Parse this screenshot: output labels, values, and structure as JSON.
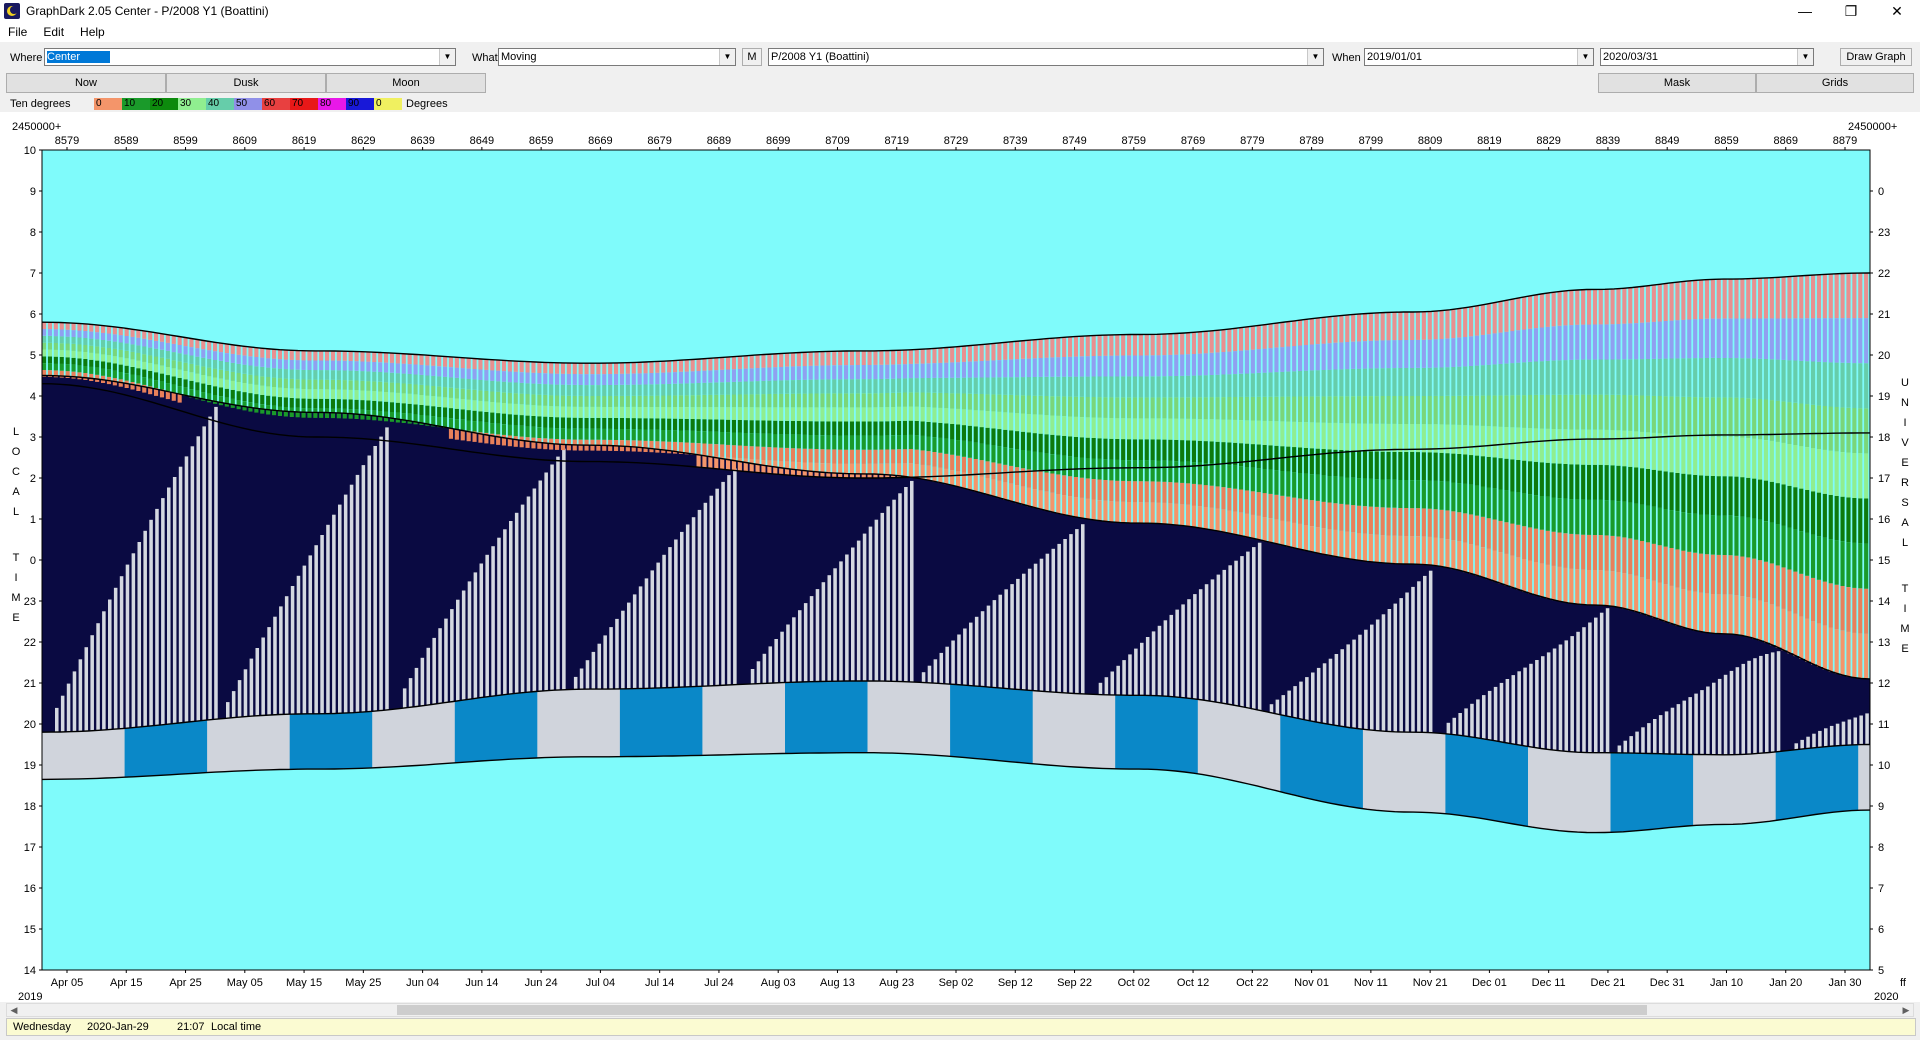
{
  "window": {
    "title": "GraphDark 2.05  Center  -  P/2008 Y1 (Boattini)"
  },
  "menu": [
    "File",
    "Edit",
    "Help"
  ],
  "toolbar": {
    "where_label": "Where",
    "where_value": "Center",
    "what_label": "What",
    "what_value": "Moving",
    "m_button": "M",
    "object_value": "P/2008 Y1 (Boattini)",
    "when_label": "When",
    "from_date": "2019/01/01",
    "to_date": "2020/03/31",
    "draw_button": "Draw Graph",
    "now_button": "Now",
    "dusk_button": "Dusk",
    "moon_button": "Moon",
    "mask_button": "Mask",
    "grids_button": "Grids"
  },
  "legend": {
    "label": "Ten degrees",
    "units": "Degrees",
    "entries": [
      {
        "value": "0",
        "color": "#f4956a"
      },
      {
        "value": "10",
        "color": "#1a9a2a"
      },
      {
        "value": "20",
        "color": "#0d8a0d"
      },
      {
        "value": "30",
        "color": "#90ee90"
      },
      {
        "value": "40",
        "color": "#66cdaa"
      },
      {
        "value": "50",
        "color": "#9090e8"
      },
      {
        "value": "60",
        "color": "#e84040"
      },
      {
        "value": "70",
        "color": "#e81818"
      },
      {
        "value": "80",
        "color": "#e818e8"
      },
      {
        "value": "90",
        "color": "#1818d8"
      },
      {
        "value": "0",
        "color": "#f0f060"
      }
    ]
  },
  "chart_data": {
    "type": "heatmap",
    "jd_prefix": "2450000+",
    "x_top_ticks": [
      "8579",
      "8589",
      "8599",
      "8609",
      "8619",
      "8629",
      "8639",
      "8649",
      "8659",
      "8669",
      "8679",
      "8689",
      "8699",
      "8709",
      "8719",
      "8729",
      "8739",
      "8749",
      "8759",
      "8769",
      "8779",
      "8789",
      "8799",
      "8809",
      "8819",
      "8829",
      "8839",
      "8849",
      "8859",
      "8869",
      "8879"
    ],
    "x_bottom_ticks": [
      "Apr 05",
      "Apr 15",
      "Apr 25",
      "May 05",
      "May 15",
      "May 25",
      "Jun 04",
      "Jun 14",
      "Jun 24",
      "Jul 04",
      "Jul 14",
      "Jul 24",
      "Aug 03",
      "Aug 13",
      "Aug 23",
      "Sep 02",
      "Sep 12",
      "Sep 22",
      "Oct 02",
      "Oct 12",
      "Oct 22",
      "Nov 01",
      "Nov 11",
      "Nov 21",
      "Dec 01",
      "Dec 11",
      "Dec 21",
      "Dec 31",
      "Jan 10",
      "Jan 20",
      "Jan 30"
    ],
    "year_start": "2019",
    "year_end": "2020",
    "corner_right": "ff",
    "y_left_ticks": [
      "10",
      "9",
      "8",
      "7",
      "6",
      "5",
      "4",
      "3",
      "2",
      "1",
      "0",
      "23",
      "22",
      "21",
      "20",
      "19",
      "18",
      "17",
      "16",
      "15",
      "14"
    ],
    "y_right_ticks": [
      "0",
      "23",
      "22",
      "21",
      "20",
      "19",
      "18",
      "17",
      "16",
      "15",
      "14",
      "13",
      "12",
      "11",
      "10",
      "9",
      "8",
      "7",
      "6",
      "5"
    ],
    "y_left_label": "LOCAL TIME",
    "y_right_label": "UNIVERSAL TIME",
    "curves": {
      "sunset": [
        [
          0,
          19.8
        ],
        [
          0.15,
          20.25
        ],
        [
          0.3,
          20.85
        ],
        [
          0.45,
          21.05
        ],
        [
          0.6,
          20.7
        ],
        [
          0.75,
          19.8
        ],
        [
          0.85,
          19.3
        ],
        [
          0.92,
          19.25
        ],
        [
          1,
          19.5
        ]
      ],
      "sunset_lower": [
        [
          0,
          18.65
        ],
        [
          0.15,
          18.9
        ],
        [
          0.3,
          19.2
        ],
        [
          0.45,
          19.3
        ],
        [
          0.6,
          18.9
        ],
        [
          0.75,
          17.85
        ],
        [
          0.85,
          17.35
        ],
        [
          0.92,
          17.55
        ],
        [
          1,
          17.9
        ]
      ],
      "target_set": [
        [
          0,
          28.3
        ],
        [
          0.15,
          27.0
        ],
        [
          0.3,
          26.4
        ],
        [
          0.45,
          26.0
        ],
        [
          0.6,
          26.25
        ],
        [
          0.75,
          26.7
        ],
        [
          0.85,
          26.95
        ],
        [
          0.92,
          27.05
        ],
        [
          1,
          27.1
        ]
      ],
      "target_high": [
        [
          0,
          29.8
        ],
        [
          0.15,
          29.1
        ],
        [
          0.3,
          28.8
        ],
        [
          0.45,
          29.1
        ],
        [
          0.6,
          29.5
        ],
        [
          0.75,
          30.05
        ],
        [
          0.85,
          30.6
        ],
        [
          0.92,
          30.85
        ],
        [
          1,
          31.0
        ]
      ],
      "sunrise": [
        [
          0,
          28.5
        ],
        [
          0.15,
          27.6
        ],
        [
          0.3,
          26.8
        ],
        [
          0.45,
          26.1
        ],
        [
          0.6,
          24.9
        ],
        [
          0.75,
          23.9
        ],
        [
          0.85,
          22.9
        ],
        [
          0.92,
          22.2
        ],
        [
          1,
          21.1
        ]
      ]
    },
    "y_range": [
      14,
      34
    ],
    "grid": false
  },
  "status": {
    "weekday": "Wednesday",
    "date": "2020-Jan-29",
    "time": "21:07",
    "time_mode": "Local time"
  }
}
